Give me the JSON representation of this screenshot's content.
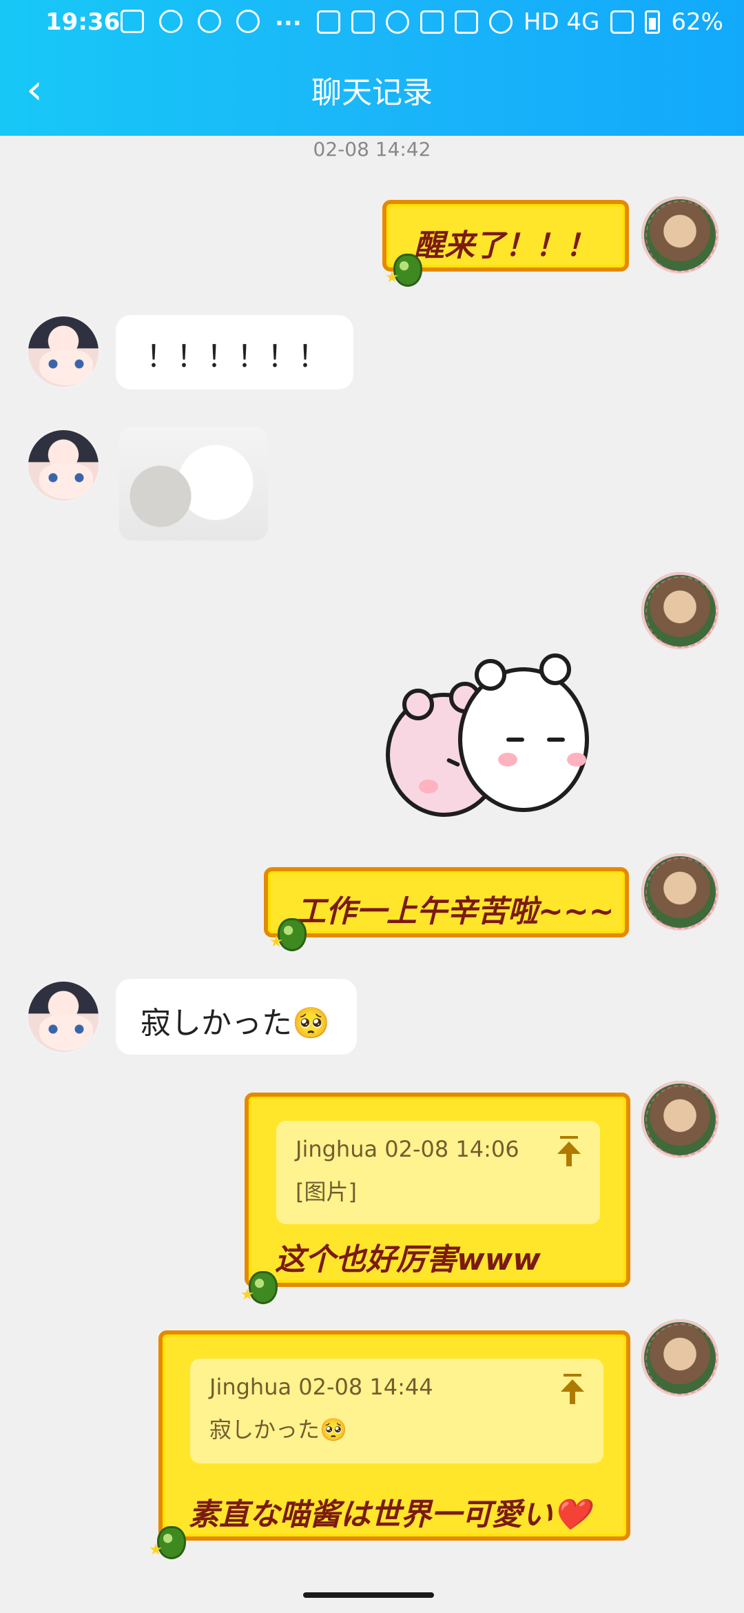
{
  "status_bar": {
    "time": "19:36",
    "network": "HD 4G",
    "battery": "62%"
  },
  "header": {
    "back_icon": "chevron-left-icon",
    "title": "聊天记录"
  },
  "timestamp": "02-08 14:42",
  "messages": [
    {
      "side": "right",
      "type": "text",
      "text": "醒来了！！！"
    },
    {
      "side": "left",
      "type": "text",
      "text": "！！！！！！"
    },
    {
      "side": "left",
      "type": "image"
    },
    {
      "side": "right",
      "type": "sticker"
    },
    {
      "side": "right",
      "type": "text",
      "text": "工作一上午辛苦啦~~~"
    },
    {
      "side": "left",
      "type": "text",
      "text": "寂しかった🥺"
    },
    {
      "side": "right",
      "type": "reply",
      "quote": {
        "author": "Jinghua 02-08 14:06",
        "content": "[图片]"
      },
      "text": "这个也好厉害www"
    },
    {
      "side": "right",
      "type": "reply",
      "quote": {
        "author": "Jinghua 02-08 14:44",
        "content": "寂しかった🥺"
      },
      "text": "素直な喵酱は世界一可愛い❤️"
    }
  ],
  "colors": {
    "header_start": "#17c8f7",
    "header_end": "#12a9fb",
    "gold_bubble": "#ffe62b",
    "gold_border": "#e58a00",
    "gold_text": "#7b1a13",
    "background": "#f0f0f0"
  }
}
